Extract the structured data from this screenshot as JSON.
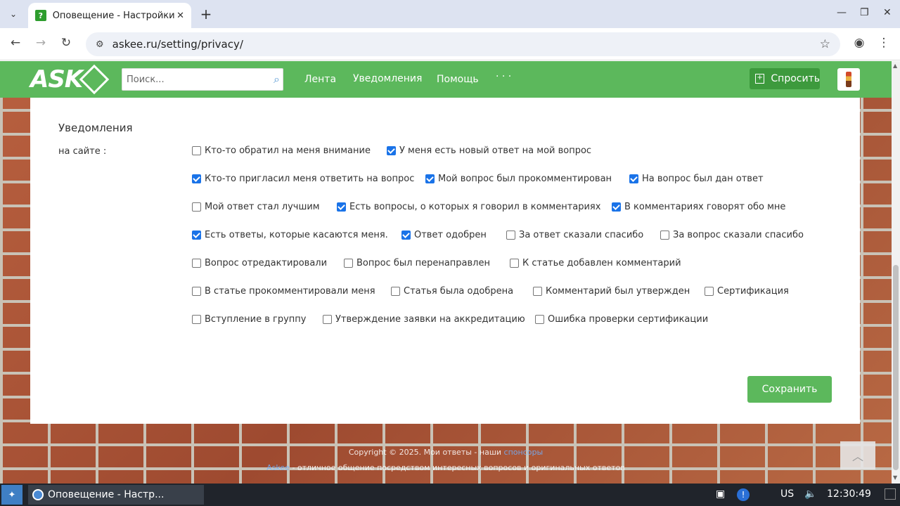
{
  "browser": {
    "tab_title": "Оповещение - Настройки",
    "favicon": "?",
    "url": "askee.ru/setting/privacy/"
  },
  "header": {
    "logo_text": "ASK",
    "search_placeholder": "Поиск...",
    "nav": [
      "Лента",
      "Уведомления",
      "Помощь",
      "· · ·"
    ],
    "ask_label": "Спросить"
  },
  "settings": {
    "section_title": "Уведомления",
    "row_label": "на сайте :",
    "options": [
      {
        "label": "Кто-то обратил на меня внимание",
        "checked": false
      },
      {
        "label": "У меня есть новый ответ на мой вопрос",
        "checked": true
      },
      {
        "label": "Кто-то пригласил меня ответить на вопрос",
        "checked": true
      },
      {
        "label": "Мой вопрос был прокомментирован",
        "checked": true
      },
      {
        "label": "На вопрос был дан ответ",
        "checked": true
      },
      {
        "label": "Мой ответ стал лучшим",
        "checked": false
      },
      {
        "label": "Есть вопросы, о которых я говорил в комментариях",
        "checked": true
      },
      {
        "label": "В комментариях говорят обо мне",
        "checked": true
      },
      {
        "label": "Есть ответы, которые касаются меня.",
        "checked": true
      },
      {
        "label": "Ответ одобрен",
        "checked": true
      },
      {
        "label": "За ответ сказали спасибо",
        "checked": false
      },
      {
        "label": "За вопрос сказали спасибо",
        "checked": false
      },
      {
        "label": "Вопрос отредактировали",
        "checked": false
      },
      {
        "label": "Вопрос был перенаправлен",
        "checked": false
      },
      {
        "label": "К статье добавлен комментарий",
        "checked": false
      },
      {
        "label": "В статье прокомментировали меня",
        "checked": false
      },
      {
        "label": "Статья была одобрена",
        "checked": false
      },
      {
        "label": "Комментарий был утвержден",
        "checked": false
      },
      {
        "label": "Сертификация",
        "checked": false
      },
      {
        "label": "Вступление в группу",
        "checked": false
      },
      {
        "label": "Утверждение заявки на аккредитацию",
        "checked": false
      },
      {
        "label": "Ошибка проверки сертификации",
        "checked": false
      }
    ],
    "save_label": "Сохранить"
  },
  "footer": {
    "line1_prefix": "Copyright © 2025. Мои ответы - наши ",
    "line1_link": "спонсоры",
    "line2_link": "Askee",
    "line2_suffix": " - отличное общение посредством интересных вопросов и оригинальных ответов"
  },
  "taskbar": {
    "window_title": "Оповещение - Настр...",
    "lang": "US",
    "clock": "12:30:49"
  }
}
